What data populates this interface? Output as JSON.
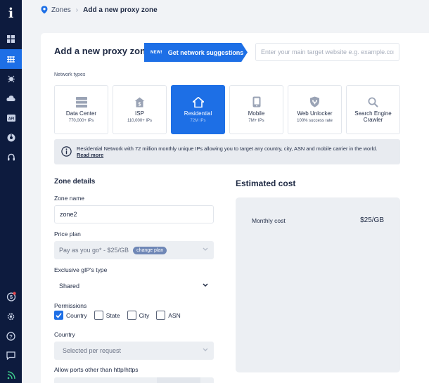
{
  "breadcrumb": {
    "zones": "Zones",
    "current": "Add a new proxy zone"
  },
  "header": {
    "title": "Add a new proxy zone",
    "suggest_badge": "NEW!",
    "suggest_label": "Get network suggestions",
    "target_placeholder": "Enter your main target website e.g. example.com"
  },
  "network_types": {
    "label": "Network types",
    "items": [
      {
        "name": "Data Center",
        "sub": "770,000+ IPs",
        "icon": "server-stack-icon"
      },
      {
        "name": "ISP",
        "sub": "110,000+ IPs",
        "icon": "dollar-house-icon"
      },
      {
        "name": "Residential",
        "sub": "72M IPs",
        "icon": "house-icon",
        "selected": true
      },
      {
        "name": "Mobile",
        "sub": "7M+ IPs",
        "icon": "mobile-phone-icon"
      },
      {
        "name": "Web Unlocker",
        "sub": "100% success rate",
        "icon": "unlock-shield-icon"
      },
      {
        "name": "Search Engine Crawler",
        "sub": "",
        "icon": "magnifier-icon"
      }
    ]
  },
  "info": {
    "text": "Residential Network with 72 million monthly unique IPs allowing you to target any country, city, ASN and mobile carrier in the world.",
    "link": "Read more"
  },
  "zone_details": {
    "heading": "Zone details",
    "zone_name_label": "Zone name",
    "zone_name_value": "zone2",
    "price_plan_label": "Price plan",
    "price_plan_value": "Pay as you go* - $25/GB",
    "change_plan": "change plan",
    "gip_label": "Exclusive gIP's type",
    "gip_value": "Shared",
    "permissions_label": "Permissions",
    "permissions": [
      {
        "label": "Country",
        "checked": true
      },
      {
        "label": "State",
        "checked": false
      },
      {
        "label": "City",
        "checked": false
      },
      {
        "label": "ASN",
        "checked": false
      }
    ],
    "country_label": "Country",
    "country_value": "Selected per request",
    "ports_label": "Allow ports other than http/https"
  },
  "cost": {
    "heading": "Estimated cost",
    "monthly_label": "Monthly cost",
    "monthly_value": "$25/GB"
  },
  "colors": {
    "accent": "#1d6fe6",
    "sidebar": "#0d1b3e",
    "page_bg": "#f1f3f6"
  }
}
